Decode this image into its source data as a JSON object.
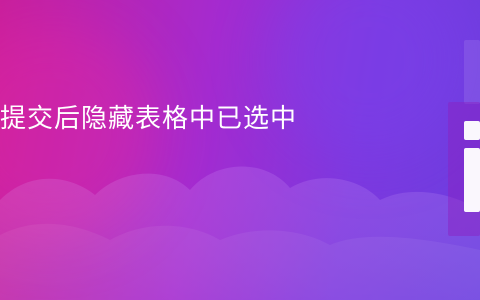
{
  "banner": {
    "headline": "提交后隐藏表格中已选中"
  },
  "colors": {
    "gradient_start": "#c81f9c",
    "gradient_end": "#6b3ee0",
    "text": "#ffffff"
  }
}
